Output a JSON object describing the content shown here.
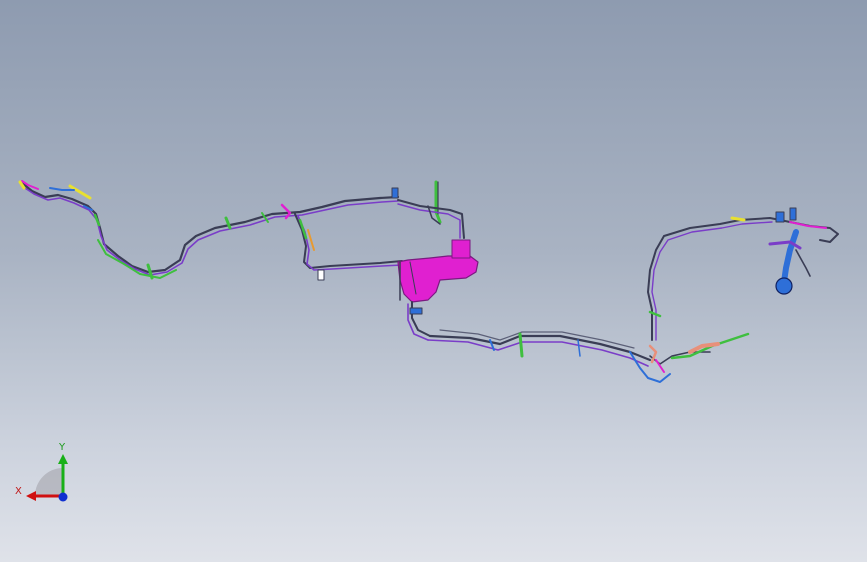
{
  "triad": {
    "x_label": "X",
    "y_label": "Y",
    "colors": {
      "x": "#d01010",
      "y": "#18b018",
      "z": "#1030d0"
    }
  },
  "colors": {
    "background_top": "#8e9bb0",
    "background_bottom": "#dfe2e9",
    "pipe_dark": "#3a3d55",
    "pipe_purple": "#7a3dc8",
    "pipe_green": "#3fbf3f",
    "pipe_magenta": "#e020d0",
    "pipe_blue": "#2e6fd8",
    "pipe_yellow": "#e8e030",
    "pipe_salmon": "#e8907a",
    "pipe_orange": "#e89a30"
  }
}
